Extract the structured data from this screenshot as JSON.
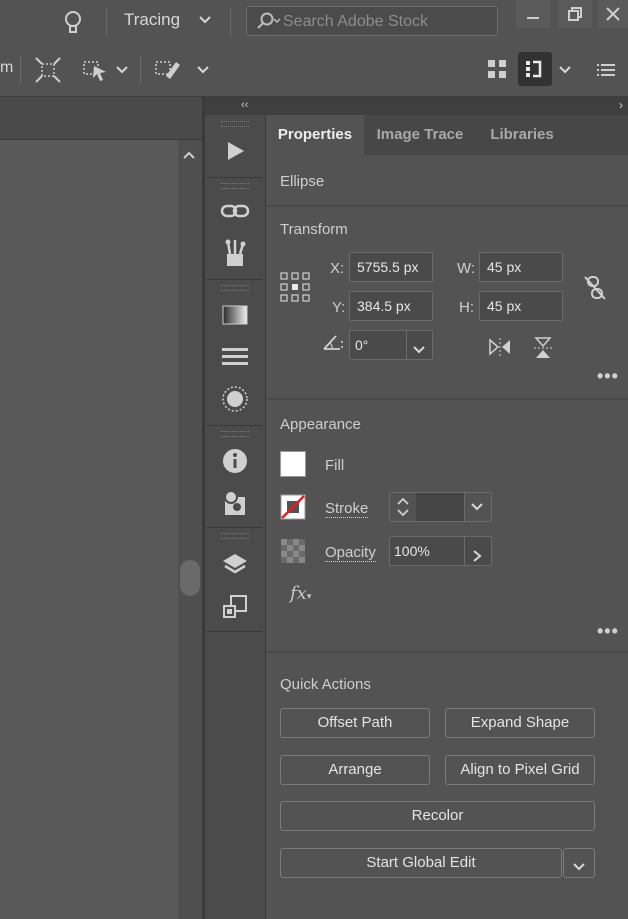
{
  "topbar": {
    "workspace_label": "Tracing",
    "search_placeholder": "Search Adobe Stock",
    "left_partial_text": "m"
  },
  "tabs": [
    "Properties",
    "Image Trace",
    "Libraries"
  ],
  "panel": {
    "object_type": "Ellipse",
    "transform": {
      "title": "Transform",
      "x_label": "X:",
      "x_value": "5755.5 px",
      "y_label": "Y:",
      "y_value": "384.5 px",
      "w_label": "W:",
      "w_value": "45 px",
      "h_label": "H:",
      "h_value": "45 px",
      "angle_value": "0°"
    },
    "appearance": {
      "title": "Appearance",
      "fill_label": "Fill",
      "stroke_label": "Stroke",
      "opacity_label": "Opacity",
      "opacity_value": "100%",
      "fx_label": "fx"
    },
    "quick_actions": {
      "title": "Quick Actions",
      "offset_path": "Offset Path",
      "expand_shape": "Expand Shape",
      "arrange": "Arrange",
      "align_pixel_grid": "Align to Pixel Grid",
      "recolor": "Recolor",
      "start_global_edit": "Start Global Edit"
    }
  },
  "colors": {
    "background": "#535353",
    "fill_swatch": "#ffffff",
    "stroke_none_slash": "#e02020"
  }
}
